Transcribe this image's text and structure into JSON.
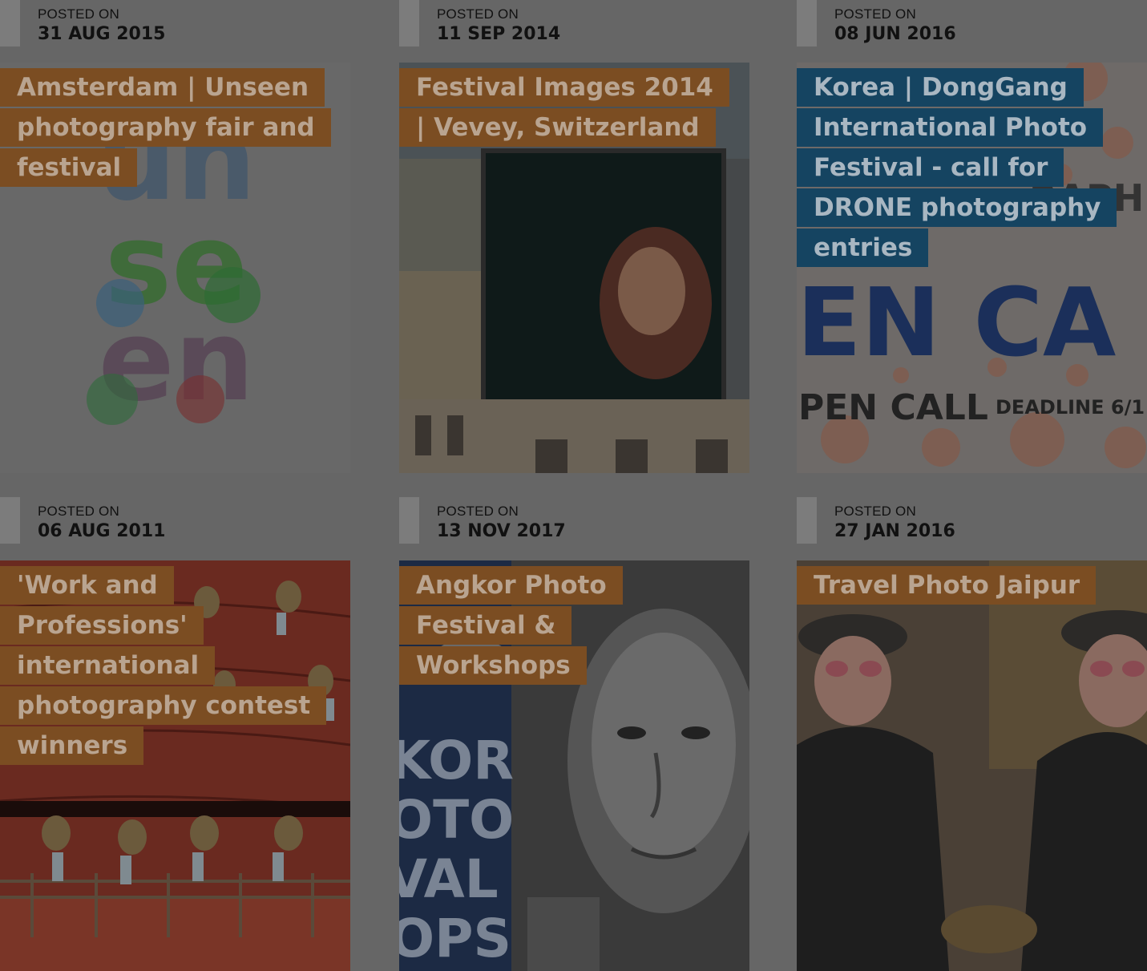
{
  "posts": [
    {
      "posted_on_label": "POSTED ON",
      "date": "31 AUG 2015",
      "title": "Amsterdam | Unseen photography fair and festival",
      "title_color": "brown",
      "image_text": [
        "un",
        "se",
        "en"
      ]
    },
    {
      "posted_on_label": "POSTED ON",
      "date": "11 SEP 2014",
      "title": "Festival Images 2014 | Vevey, Switzerland",
      "title_color": "brown"
    },
    {
      "posted_on_label": "POSTED ON",
      "date": "08 JUN 2016",
      "title": "Korea | DongGang International Photo Festival - call for DRONE photography entries",
      "title_color": "blue",
      "image_text": [
        "RAPH",
        "EN CA",
        "PEN CALL",
        "DEADLINE 6/1"
      ]
    },
    {
      "posted_on_label": "POSTED ON",
      "date": "06 AUG 2011",
      "title": "'Work and Professions' international photography contest winners",
      "title_color": "brown"
    },
    {
      "posted_on_label": "POSTED ON",
      "date": "13 NOV 2017",
      "title": "Angkor Photo Festival & Workshops",
      "title_color": "brown",
      "image_text": [
        "KOR",
        "OTO",
        "VAL",
        "OPS"
      ]
    },
    {
      "posted_on_label": "POSTED ON",
      "date": "27 JAN 2016",
      "title": "Travel Photo Jaipur",
      "title_color": "brown"
    }
  ],
  "colors": {
    "overlay_bg": "#666666",
    "title_brown": "#7b4d22",
    "title_blue": "#154461",
    "date_bar": "#7c7c7c"
  }
}
